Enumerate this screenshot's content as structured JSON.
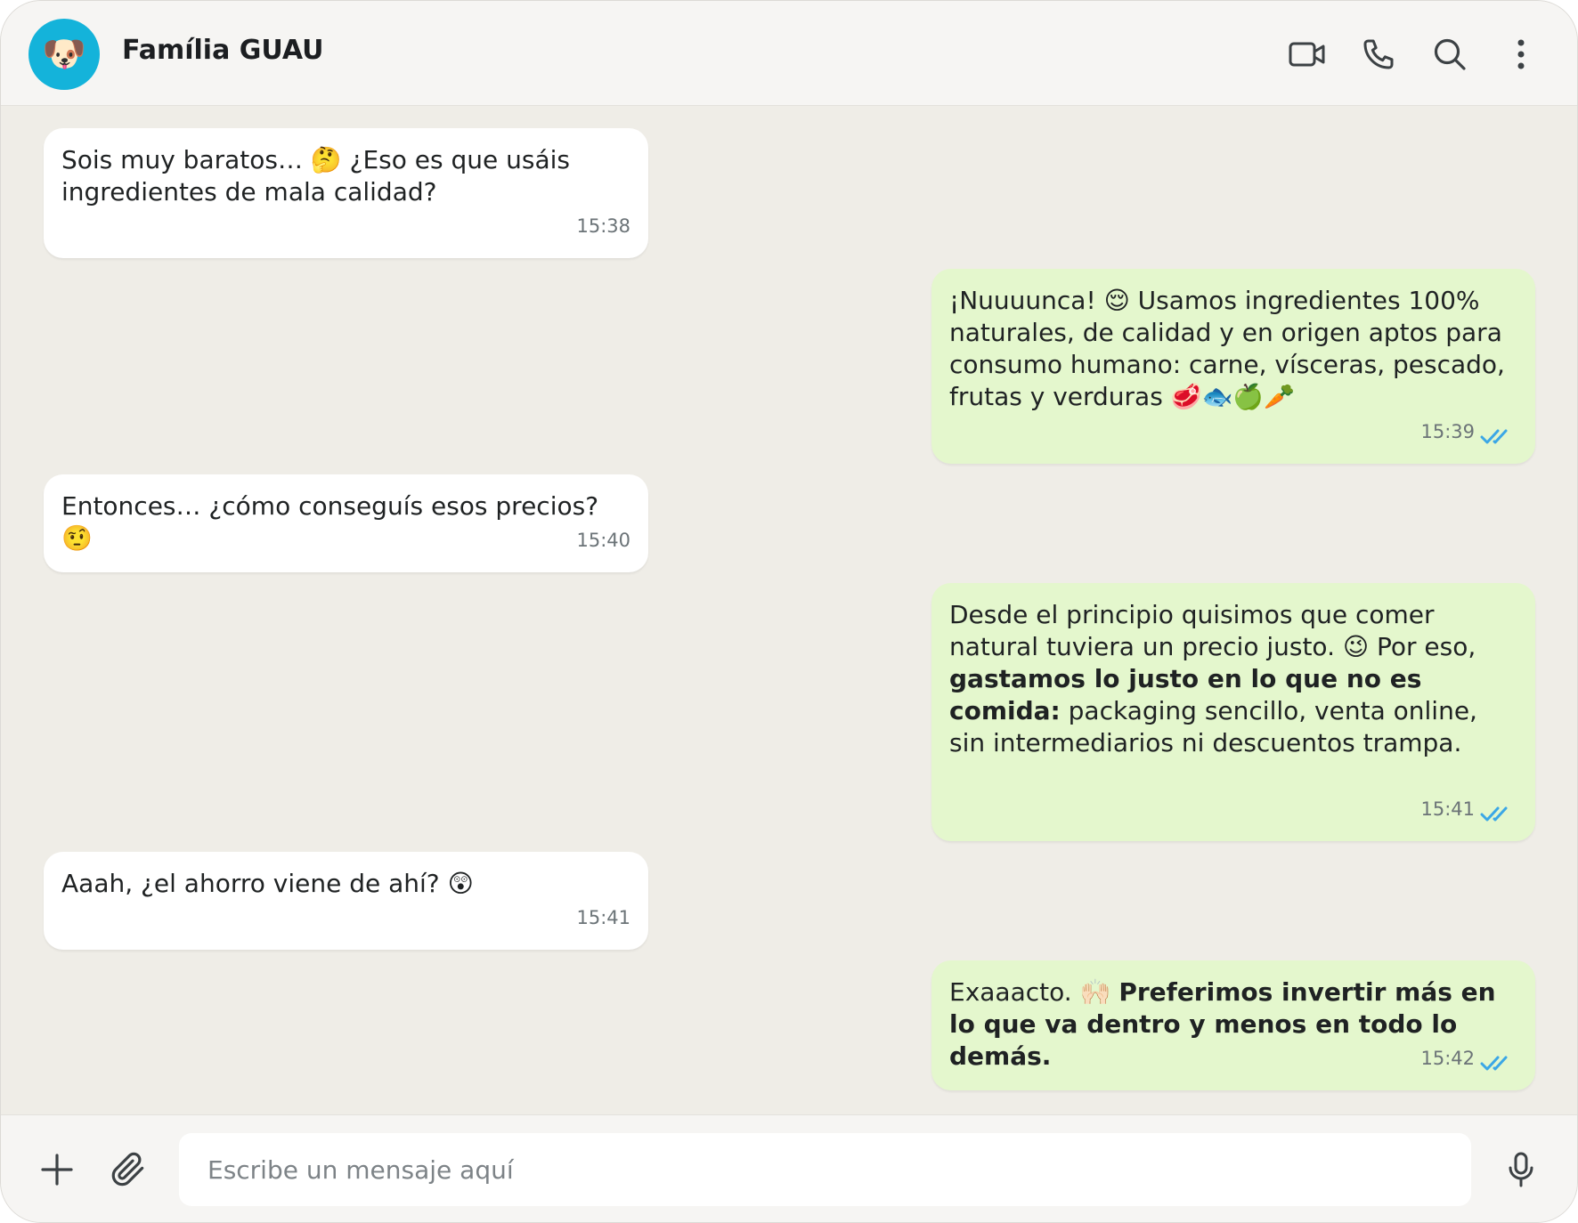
{
  "header": {
    "avatar_emoji": "🐶",
    "title": "Família GUAU",
    "icons": [
      "video-call-icon",
      "voice-call-icon",
      "search-icon",
      "more-options-icon"
    ]
  },
  "messages": [
    {
      "direction": "incoming",
      "text": "Sois muy baratos… 🤔 ¿Eso es que usáis ingredientes de mala calidad?",
      "time": "15:38"
    },
    {
      "direction": "outgoing",
      "text": "¡Nuuuunca! 😌 Usamos ingredientes 100% naturales, de calidad y en origen aptos para consumo humano: carne, vísceras, pescado, frutas y verduras 🥩🐟🍏🥕",
      "time": "15:39",
      "status": "read"
    },
    {
      "direction": "incoming",
      "text": "Entonces… ¿cómo conseguís esos precios? 🤨",
      "time": "15:40"
    },
    {
      "direction": "outgoing",
      "text_before": "Desde el principio quisimos que comer natural tuviera un precio justo. 😉 Por eso, ",
      "text_bold": "gastamos lo justo en lo que no es comida:",
      "text_after": " packaging sencillo, venta online, sin intermediarios ni descuentos trampa.",
      "time": "15:41",
      "status": "read"
    },
    {
      "direction": "incoming",
      "text": "Aaah, ¿el ahorro viene de ahí? 😲",
      "time": "15:41"
    },
    {
      "direction": "outgoing",
      "text_before": "Exaaacto. 🙌🏻 ",
      "text_bold": "Preferimos invertir más en lo que va dentro y menos en todo lo demás.",
      "time": "15:42",
      "status": "read"
    }
  ],
  "composer": {
    "placeholder": "Escribe un mensaje aquí",
    "value": "",
    "icons": [
      "plus-icon",
      "attach-icon",
      "microphone-icon"
    ]
  },
  "colors": {
    "chat_background": "#efede7",
    "incoming_bubble": "#ffffff",
    "outgoing_bubble": "#e4f7cd",
    "read_ticks": "#3ba7e6",
    "avatar_background": "#14b3da"
  }
}
